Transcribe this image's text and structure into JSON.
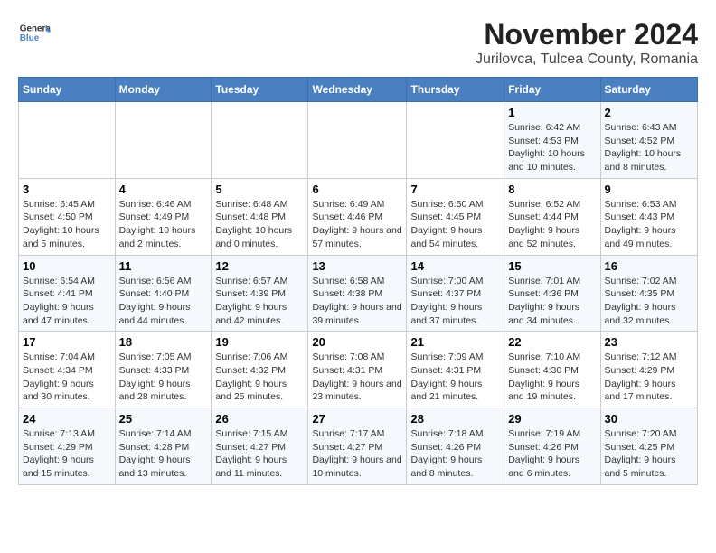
{
  "logo": {
    "general": "General",
    "blue": "Blue"
  },
  "title": "November 2024",
  "subtitle": "Jurilovca, Tulcea County, Romania",
  "days_of_week": [
    "Sunday",
    "Monday",
    "Tuesday",
    "Wednesday",
    "Thursday",
    "Friday",
    "Saturday"
  ],
  "weeks": [
    [
      {
        "day": "",
        "info": ""
      },
      {
        "day": "",
        "info": ""
      },
      {
        "day": "",
        "info": ""
      },
      {
        "day": "",
        "info": ""
      },
      {
        "day": "",
        "info": ""
      },
      {
        "day": "1",
        "info": "Sunrise: 6:42 AM\nSunset: 4:53 PM\nDaylight: 10 hours and 10 minutes."
      },
      {
        "day": "2",
        "info": "Sunrise: 6:43 AM\nSunset: 4:52 PM\nDaylight: 10 hours and 8 minutes."
      }
    ],
    [
      {
        "day": "3",
        "info": "Sunrise: 6:45 AM\nSunset: 4:50 PM\nDaylight: 10 hours and 5 minutes."
      },
      {
        "day": "4",
        "info": "Sunrise: 6:46 AM\nSunset: 4:49 PM\nDaylight: 10 hours and 2 minutes."
      },
      {
        "day": "5",
        "info": "Sunrise: 6:48 AM\nSunset: 4:48 PM\nDaylight: 10 hours and 0 minutes."
      },
      {
        "day": "6",
        "info": "Sunrise: 6:49 AM\nSunset: 4:46 PM\nDaylight: 9 hours and 57 minutes."
      },
      {
        "day": "7",
        "info": "Sunrise: 6:50 AM\nSunset: 4:45 PM\nDaylight: 9 hours and 54 minutes."
      },
      {
        "day": "8",
        "info": "Sunrise: 6:52 AM\nSunset: 4:44 PM\nDaylight: 9 hours and 52 minutes."
      },
      {
        "day": "9",
        "info": "Sunrise: 6:53 AM\nSunset: 4:43 PM\nDaylight: 9 hours and 49 minutes."
      }
    ],
    [
      {
        "day": "10",
        "info": "Sunrise: 6:54 AM\nSunset: 4:41 PM\nDaylight: 9 hours and 47 minutes."
      },
      {
        "day": "11",
        "info": "Sunrise: 6:56 AM\nSunset: 4:40 PM\nDaylight: 9 hours and 44 minutes."
      },
      {
        "day": "12",
        "info": "Sunrise: 6:57 AM\nSunset: 4:39 PM\nDaylight: 9 hours and 42 minutes."
      },
      {
        "day": "13",
        "info": "Sunrise: 6:58 AM\nSunset: 4:38 PM\nDaylight: 9 hours and 39 minutes."
      },
      {
        "day": "14",
        "info": "Sunrise: 7:00 AM\nSunset: 4:37 PM\nDaylight: 9 hours and 37 minutes."
      },
      {
        "day": "15",
        "info": "Sunrise: 7:01 AM\nSunset: 4:36 PM\nDaylight: 9 hours and 34 minutes."
      },
      {
        "day": "16",
        "info": "Sunrise: 7:02 AM\nSunset: 4:35 PM\nDaylight: 9 hours and 32 minutes."
      }
    ],
    [
      {
        "day": "17",
        "info": "Sunrise: 7:04 AM\nSunset: 4:34 PM\nDaylight: 9 hours and 30 minutes."
      },
      {
        "day": "18",
        "info": "Sunrise: 7:05 AM\nSunset: 4:33 PM\nDaylight: 9 hours and 28 minutes."
      },
      {
        "day": "19",
        "info": "Sunrise: 7:06 AM\nSunset: 4:32 PM\nDaylight: 9 hours and 25 minutes."
      },
      {
        "day": "20",
        "info": "Sunrise: 7:08 AM\nSunset: 4:31 PM\nDaylight: 9 hours and 23 minutes."
      },
      {
        "day": "21",
        "info": "Sunrise: 7:09 AM\nSunset: 4:31 PM\nDaylight: 9 hours and 21 minutes."
      },
      {
        "day": "22",
        "info": "Sunrise: 7:10 AM\nSunset: 4:30 PM\nDaylight: 9 hours and 19 minutes."
      },
      {
        "day": "23",
        "info": "Sunrise: 7:12 AM\nSunset: 4:29 PM\nDaylight: 9 hours and 17 minutes."
      }
    ],
    [
      {
        "day": "24",
        "info": "Sunrise: 7:13 AM\nSunset: 4:29 PM\nDaylight: 9 hours and 15 minutes."
      },
      {
        "day": "25",
        "info": "Sunrise: 7:14 AM\nSunset: 4:28 PM\nDaylight: 9 hours and 13 minutes."
      },
      {
        "day": "26",
        "info": "Sunrise: 7:15 AM\nSunset: 4:27 PM\nDaylight: 9 hours and 11 minutes."
      },
      {
        "day": "27",
        "info": "Sunrise: 7:17 AM\nSunset: 4:27 PM\nDaylight: 9 hours and 10 minutes."
      },
      {
        "day": "28",
        "info": "Sunrise: 7:18 AM\nSunset: 4:26 PM\nDaylight: 9 hours and 8 minutes."
      },
      {
        "day": "29",
        "info": "Sunrise: 7:19 AM\nSunset: 4:26 PM\nDaylight: 9 hours and 6 minutes."
      },
      {
        "day": "30",
        "info": "Sunrise: 7:20 AM\nSunset: 4:25 PM\nDaylight: 9 hours and 5 minutes."
      }
    ]
  ]
}
